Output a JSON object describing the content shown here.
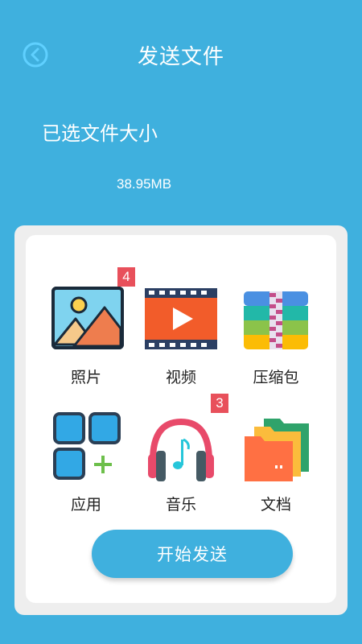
{
  "header": {
    "title": "发送文件"
  },
  "summary": {
    "label": "已选文件大小",
    "value": "38.95MB"
  },
  "categories": [
    {
      "label": "照片",
      "badge": "4",
      "icon": "photo-icon"
    },
    {
      "label": "视频",
      "badge": "",
      "icon": "video-icon"
    },
    {
      "label": "压缩包",
      "badge": "",
      "icon": "archive-icon"
    },
    {
      "label": "应用",
      "badge": "",
      "icon": "apps-icon"
    },
    {
      "label": "音乐",
      "badge": "3",
      "icon": "music-icon"
    },
    {
      "label": "文档",
      "badge": "",
      "icon": "document-icon"
    }
  ],
  "actions": {
    "start_label": "开始发送"
  },
  "colors": {
    "background": "#3fb0de",
    "badge": "#e8505b",
    "button": "#3fb0de"
  }
}
